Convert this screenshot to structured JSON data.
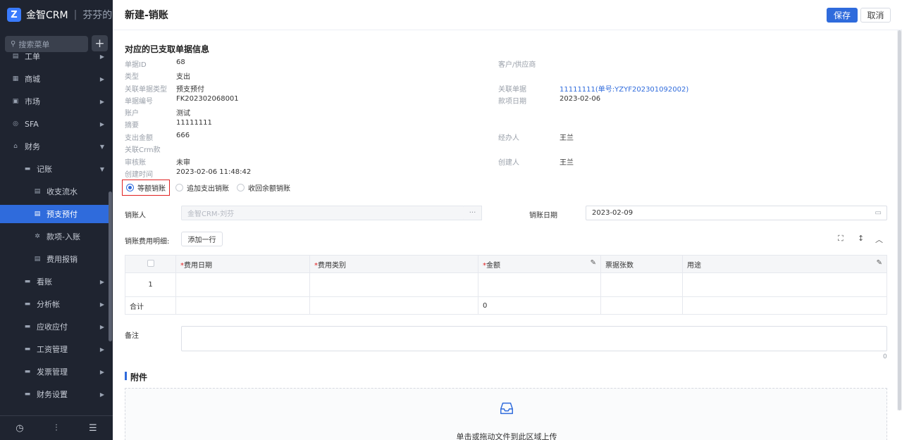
{
  "sidebar": {
    "brand": "金智CRM",
    "separator": "|",
    "team": "芬芬的团",
    "search_placeholder": "搜索菜单",
    "items": [
      {
        "label": "工单"
      },
      {
        "label": "商城"
      },
      {
        "label": "市场"
      },
      {
        "label": "SFA"
      },
      {
        "label": "财务"
      },
      {
        "label": "记账"
      },
      {
        "label": "收支流水"
      },
      {
        "label": "预支预付"
      },
      {
        "label": "款项-入账"
      },
      {
        "label": "费用报销"
      },
      {
        "label": "看账"
      },
      {
        "label": "分析帐"
      },
      {
        "label": "应收应付"
      },
      {
        "label": "工资管理"
      },
      {
        "label": "发票管理"
      },
      {
        "label": "财务设置"
      }
    ]
  },
  "header": {
    "title": "新建-销账",
    "save_label": "保存",
    "cancel_label": "取消"
  },
  "info": {
    "section_title": "对应的已支取单据信息",
    "left": [
      {
        "label": "单据ID",
        "value": "68"
      },
      {
        "label": "类型",
        "value": "支出"
      },
      {
        "label": "关联单据类型",
        "value": "预支预付"
      },
      {
        "label": "单据编号",
        "value": "FK202302068001"
      },
      {
        "label": "账户",
        "value": "测试"
      },
      {
        "label": "摘要",
        "value": "11111111"
      },
      {
        "label": "支出金额",
        "value": "666"
      },
      {
        "label": "关联Crm款",
        "value": ""
      },
      {
        "label": "审核账",
        "value": "未审"
      },
      {
        "label": "创建时间",
        "value": "2023-02-06 11:48:42"
      }
    ],
    "right": [
      {
        "label": "客户/供应商",
        "value": ""
      },
      {
        "label": "关联单据",
        "value": "11111111(单号:YZYF202301092002)"
      },
      {
        "label": "款项日期",
        "value": "2023-02-06"
      },
      {
        "label": "经办人",
        "value": "王兰"
      },
      {
        "label": "创建人",
        "value": "王兰"
      }
    ]
  },
  "radio": {
    "options": [
      "等额销账",
      "追加支出销账",
      "收回余额销账"
    ],
    "selected": "等额销账"
  },
  "form": {
    "person_label": "销账人",
    "person_value": "金智CRM-刘芬",
    "date_label": "销账日期",
    "date_value": "2023-02-09",
    "detail_label": "销账费用明细:",
    "add_row_label": "添加一行",
    "remark_label": "备注",
    "remark_count": "0"
  },
  "table": {
    "columns": [
      "费用日期",
      "费用类别",
      "金额",
      "票据张数",
      "用途"
    ],
    "row_index": "1",
    "total_label": "合计",
    "total_amount": "0"
  },
  "attachment": {
    "title": "附件",
    "hint": "单击或拖动文件到此区域上传"
  },
  "colors": {
    "primary": "#2f6bdc",
    "sidebar_bg": "#1f2430",
    "highlight_border": "#e02020"
  }
}
